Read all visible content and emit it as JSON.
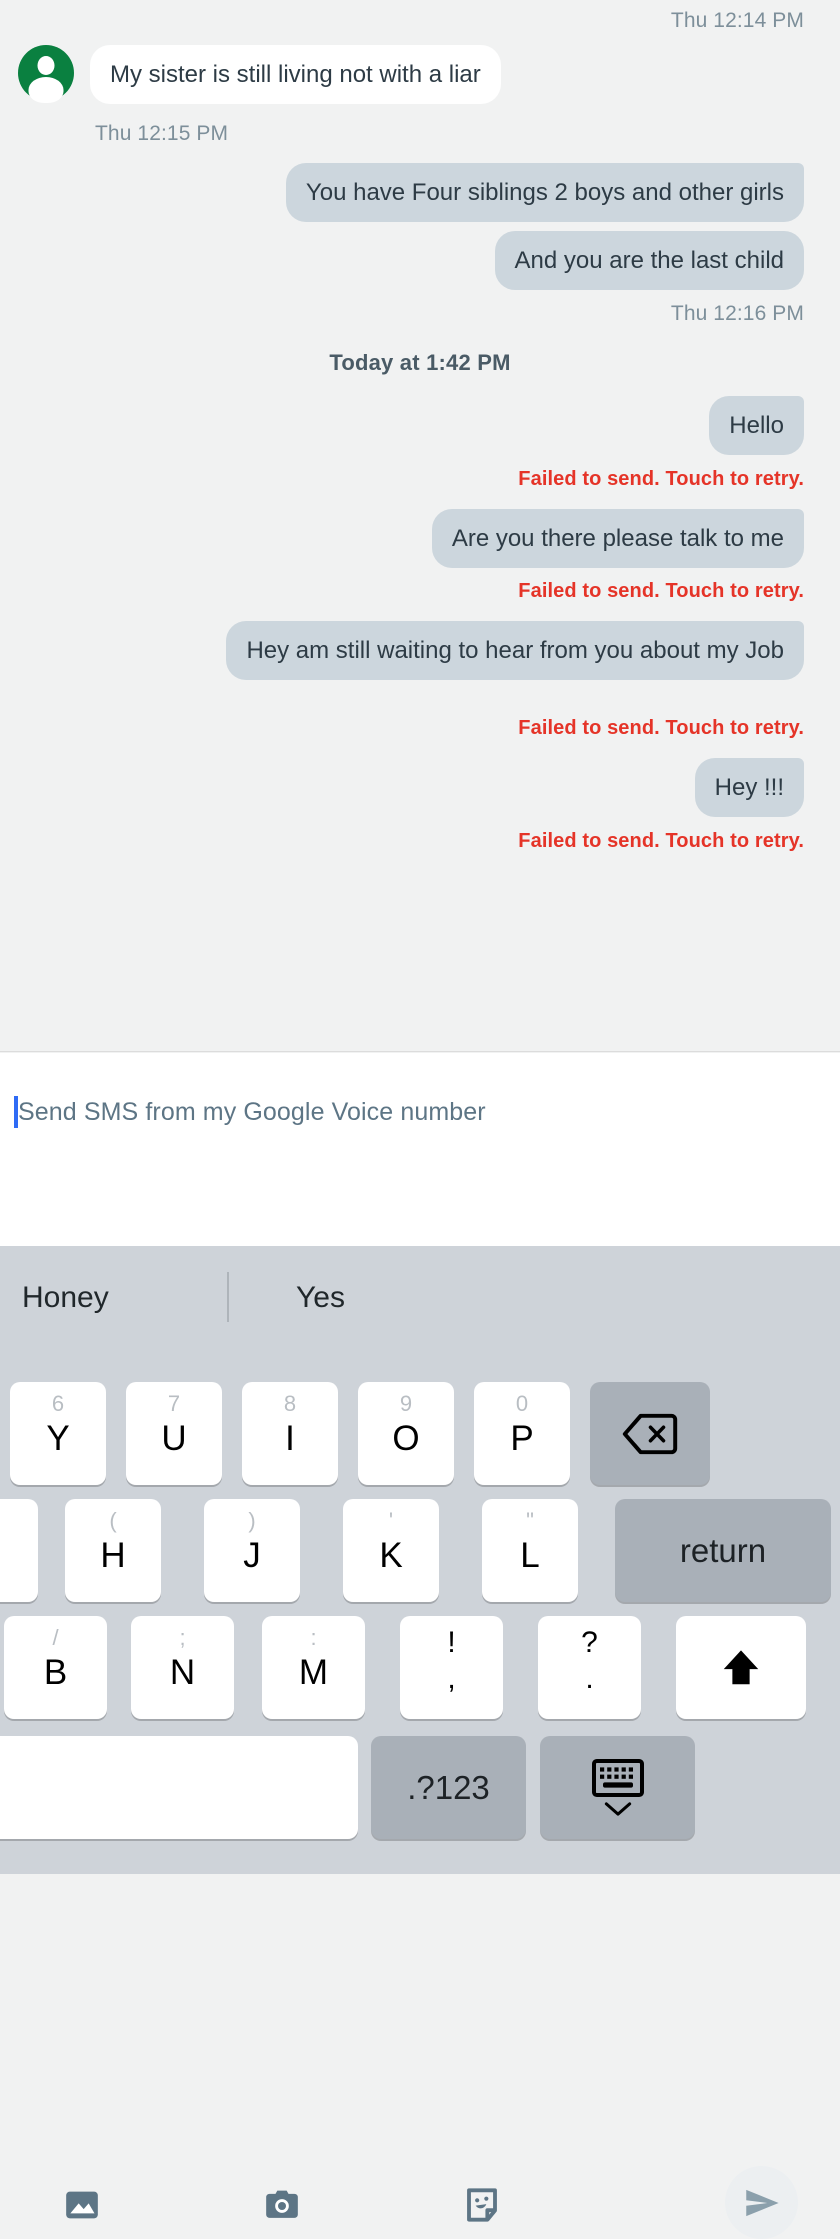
{
  "conversation": {
    "messages": [
      {
        "kind": "timestamp",
        "align": "right",
        "text": "Thu 12:14 PM"
      },
      {
        "kind": "incoming",
        "text": "My sister is still living  not with a liar",
        "avatar": "person-avatar"
      },
      {
        "kind": "timestamp",
        "align": "left",
        "text": "Thu 12:15 PM"
      },
      {
        "kind": "outgoing",
        "text": "You have Four siblings 2 boys and other girls"
      },
      {
        "kind": "outgoing",
        "text": "And you are the last child"
      },
      {
        "kind": "timestamp",
        "align": "right",
        "text": "Thu 12:16 PM"
      },
      {
        "kind": "daystamp",
        "text": "Today at 1:42 PM"
      },
      {
        "kind": "outgoing",
        "text": "Hello"
      },
      {
        "kind": "error",
        "text": "Failed to send. Touch to retry."
      },
      {
        "kind": "outgoing",
        "text": "Are you there please talk to me"
      },
      {
        "kind": "error",
        "text": "Failed to send. Touch to retry."
      },
      {
        "kind": "outgoing",
        "text": "Hey am still waiting to hear from you about my Job"
      },
      {
        "kind": "error",
        "text": "Failed to send. Touch to retry."
      },
      {
        "kind": "outgoing",
        "text": "Hey !!!"
      },
      {
        "kind": "error",
        "text": "Failed to send. Touch to retry."
      }
    ],
    "colors": {
      "background": "#f1f2f2",
      "incoming_bubble": "#ffffff",
      "outgoing_bubble": "#ccd6dd",
      "text": "#2d3b45",
      "timestamp": "#7d8f9a",
      "error": "#e53428",
      "avatar": "#0a8040"
    }
  },
  "compose": {
    "placeholder": "Send SMS from my Google Voice number",
    "value": "",
    "caret_color": "#2f6bf5",
    "attachments": [
      {
        "name": "gallery-icon",
        "label": "Gallery"
      },
      {
        "name": "camera-icon",
        "label": "Camera"
      },
      {
        "name": "sticker-icon",
        "label": "Sticker"
      }
    ],
    "send_button": {
      "name": "send-icon",
      "label": "Send"
    }
  },
  "keyboard": {
    "suggestions": [
      "Honey",
      "Yes"
    ],
    "rows": [
      {
        "id": "row-1",
        "keys": [
          {
            "main": "Y",
            "alt": "6"
          },
          {
            "main": "U",
            "alt": "7"
          },
          {
            "main": "I",
            "alt": "8"
          },
          {
            "main": "O",
            "alt": "9"
          },
          {
            "main": "P",
            "alt": "0"
          },
          {
            "main": "backspace-icon",
            "alt": "",
            "type": "special",
            "label": "Backspace"
          }
        ]
      },
      {
        "id": "row-2",
        "keys": [
          {
            "main": "",
            "alt": "",
            "type": "partial"
          },
          {
            "main": "H",
            "alt": "("
          },
          {
            "main": "J",
            "alt": ")"
          },
          {
            "main": "K",
            "alt": "'"
          },
          {
            "main": "L",
            "alt": "\""
          },
          {
            "main": "return",
            "alt": "",
            "type": "special",
            "label": "Return"
          }
        ]
      },
      {
        "id": "row-3",
        "keys": [
          {
            "main": "B",
            "alt": "/"
          },
          {
            "main": "N",
            "alt": ";"
          },
          {
            "main": "M",
            "alt": ":"
          },
          {
            "main": ",",
            "alt": "!",
            "type": "punct"
          },
          {
            "main": ".",
            "alt": "?",
            "type": "punct"
          },
          {
            "main": "shift-icon",
            "alt": "",
            "type": "glyph",
            "label": "Shift"
          }
        ]
      },
      {
        "id": "row-4",
        "keys": [
          {
            "main": "",
            "alt": "",
            "type": "space",
            "label": "Space"
          },
          {
            "main": ".?123",
            "alt": "",
            "type": "symbols",
            "label": "Symbols"
          },
          {
            "main": "hide-keyboard-icon",
            "alt": "",
            "type": "glyph",
            "label": "Hide keyboard"
          }
        ]
      }
    ],
    "colors": {
      "background": "#ced3d9",
      "key": "#ffffff",
      "special_key": "#a9b0b8",
      "alt_text": "#b9bec3",
      "main_text": "#000000"
    }
  }
}
